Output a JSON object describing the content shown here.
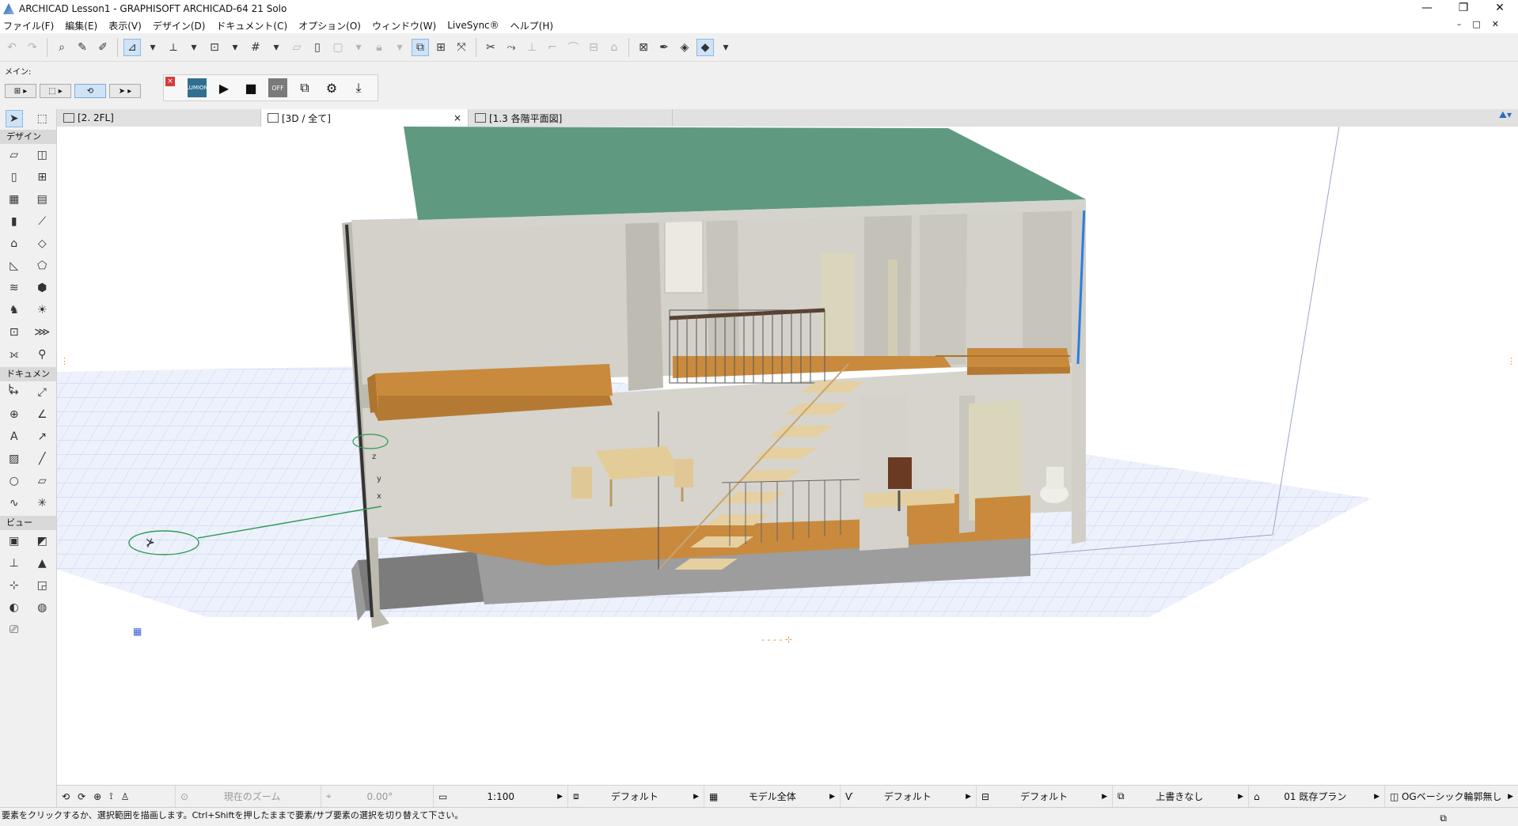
{
  "window": {
    "title": "ARCHICAD Lesson1 - GRAPHISOFT ARCHICAD-64 21 Solo",
    "controls": [
      "—",
      "❐",
      "✕"
    ]
  },
  "menubar": {
    "items": [
      "ファイル(F)",
      "編集(E)",
      "表示(V)",
      "デザイン(D)",
      "ドキュメント(C)",
      "オプション(O)",
      "ウィンドウ(W)",
      "LiveSync®",
      "ヘルプ(H)"
    ]
  },
  "toolbar2": {
    "main_label": "メイン:"
  },
  "lumion": {
    "logo_label": "LUMION",
    "off_label": "OFF"
  },
  "tabs": [
    {
      "label": "[2. 2FL]"
    },
    {
      "label": "[3D / 全て]",
      "close": "×"
    },
    {
      "label": "[1.3 各階平面図]"
    }
  ],
  "toolbox": {
    "sections": {
      "design": "デザイン",
      "document": "ドキュメント",
      "view": "ビュー"
    }
  },
  "statusbar": {
    "zoom": "現在のズーム",
    "angle": "0.00°",
    "scale": "1:100",
    "layer": "デフォルト",
    "model": "モデル全体",
    "pen": "デフォルト",
    "structure": "デフォルト",
    "override": "上書きなし",
    "renovation": "01 既存プラン",
    "graphic": "OGベーシック輪郭無し"
  },
  "message": "要素をクリックするか、選択範囲を描画します。Ctrl+Shiftを押したままで要素/サブ要素の選択を切り替えて下さい。",
  "colors": {
    "roof": "#5f9a80",
    "wall": "#cfcdc4",
    "floor_wood": "#c98a3e",
    "grid": "#b8c8ee",
    "selection_blue": "#2a7de0",
    "accent_green": "#2e9a54"
  }
}
